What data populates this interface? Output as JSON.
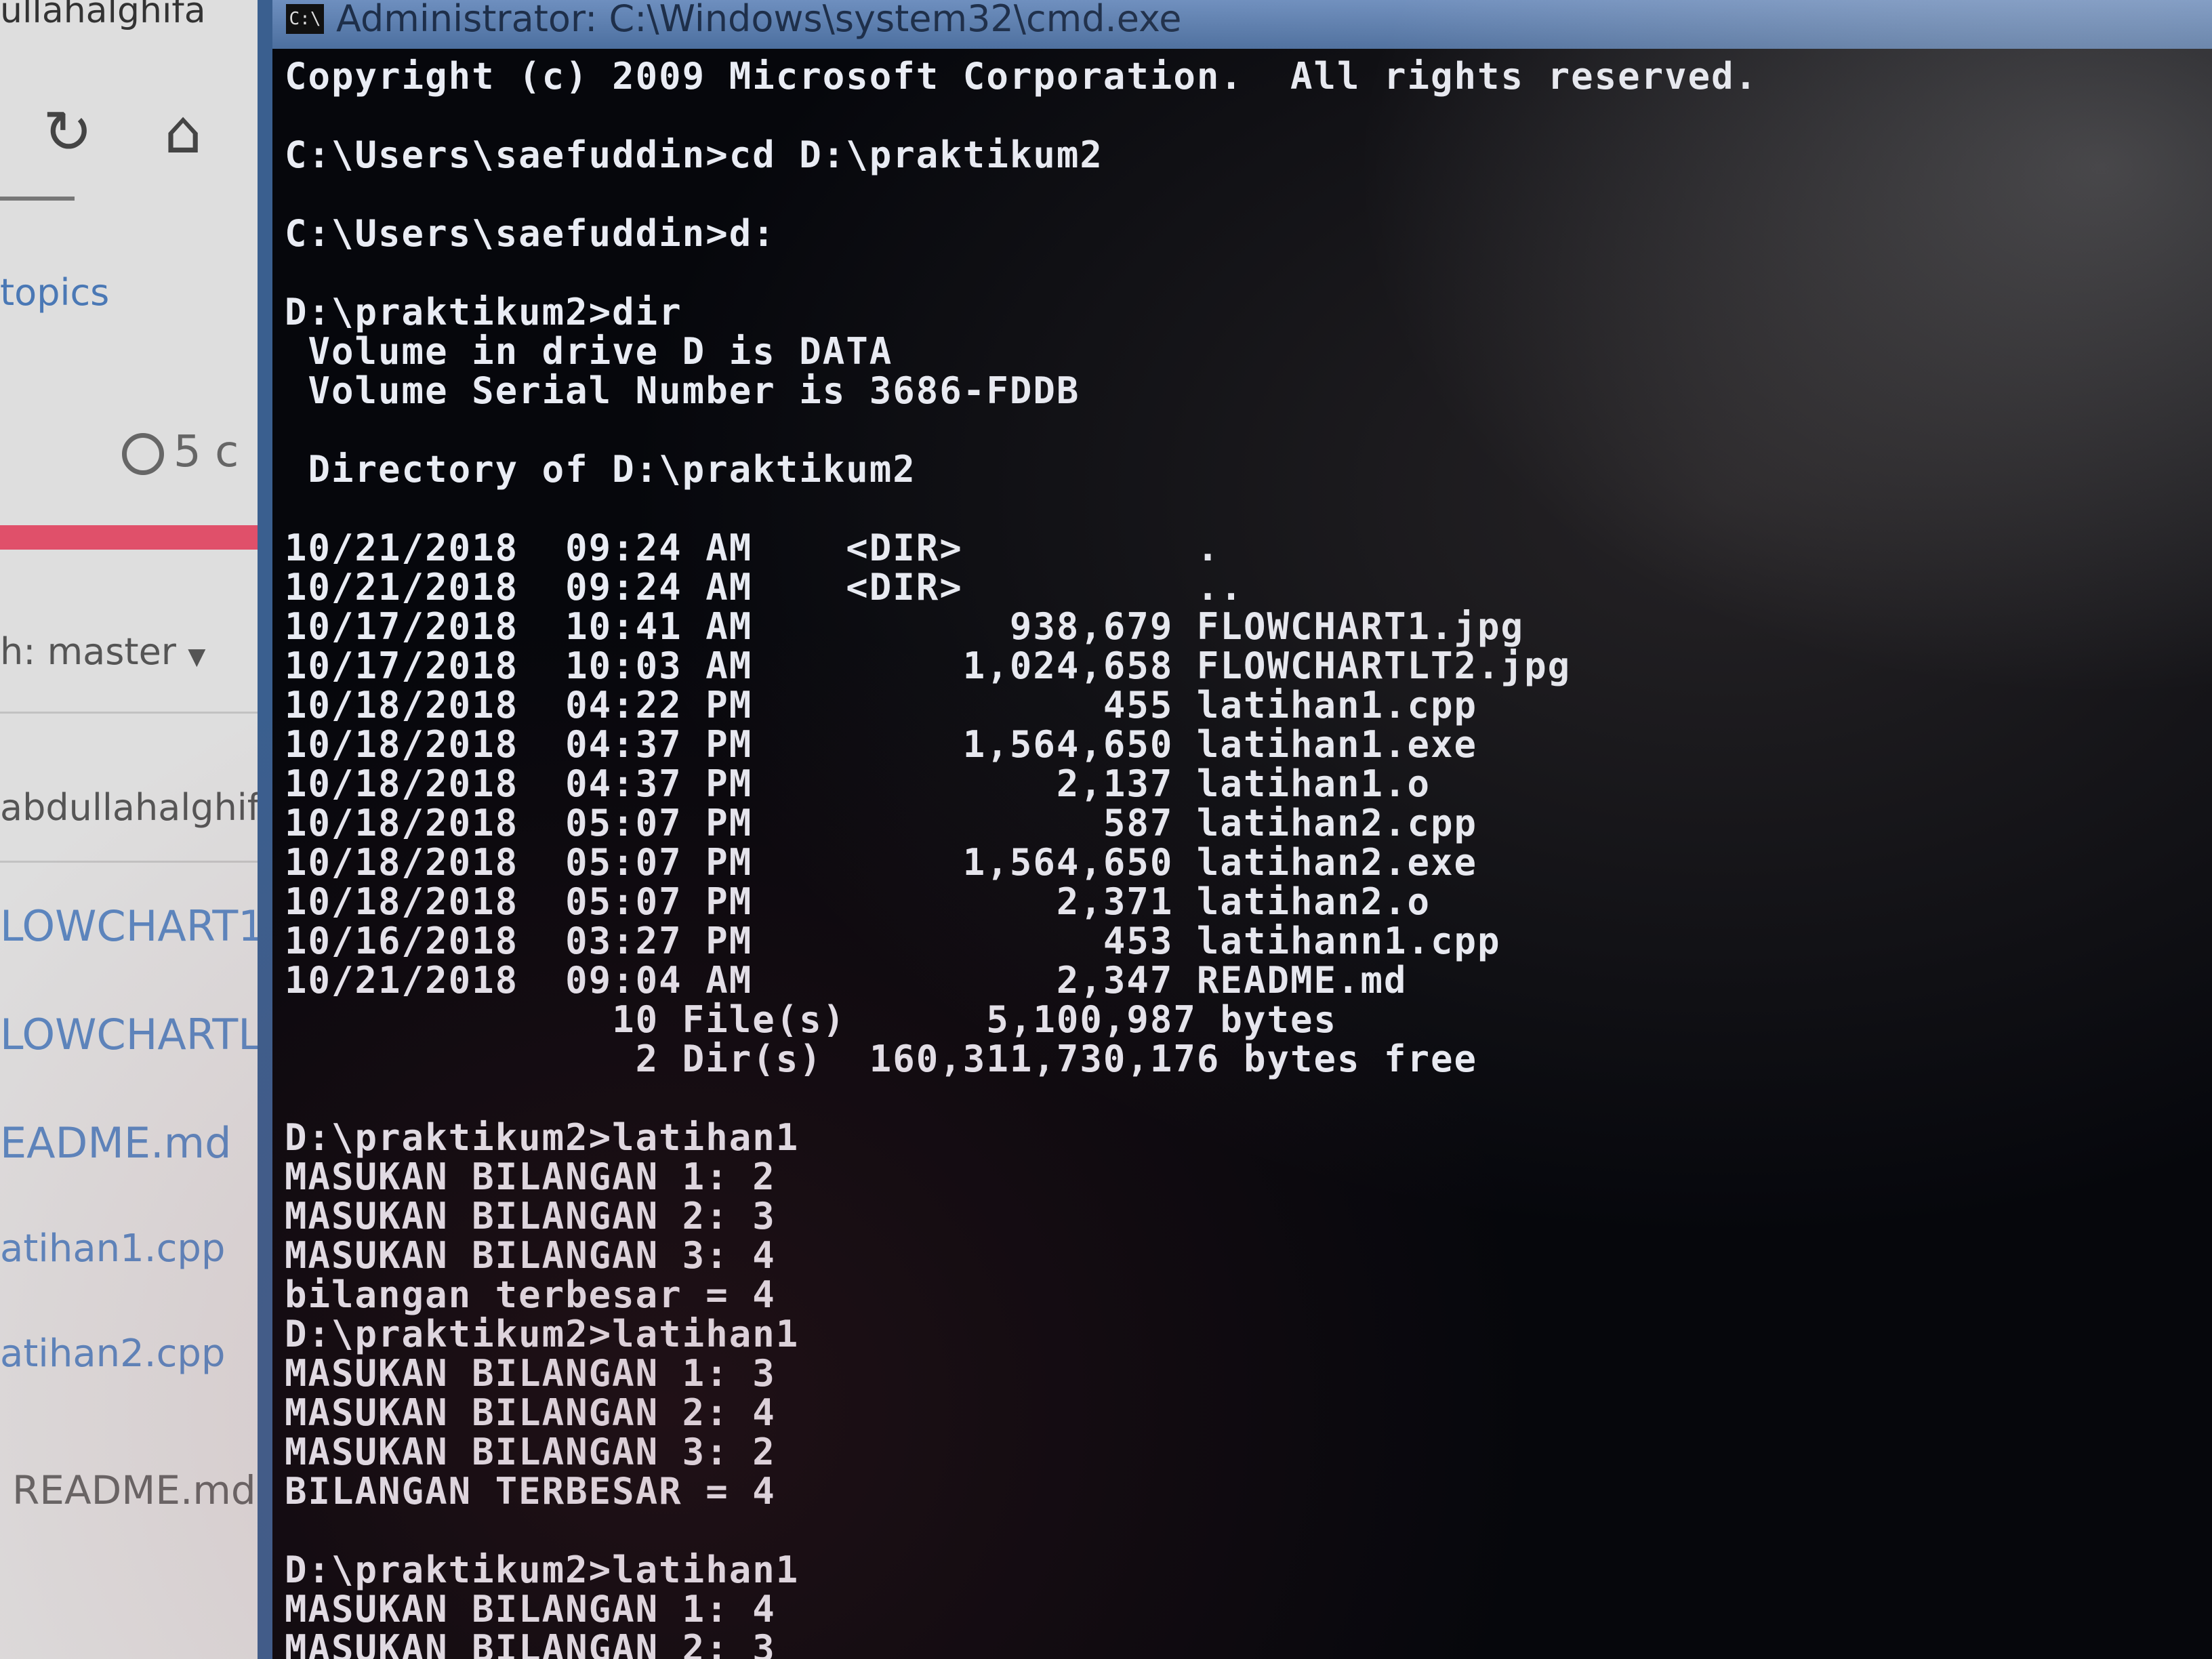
{
  "browser": {
    "url_fragment": "ullahalghifa",
    "reload_icon": "reload-icon",
    "home_icon": "home-icon",
    "topics_link": "topics",
    "history_count": "5 c",
    "branch_label": "h: master",
    "commit_author": "abdullahalghif",
    "files": [
      "LOWCHART1",
      "LOWCHARTL",
      "EADME.md",
      "atihan1.cpp",
      "atihan2.cpp",
      "README.md"
    ]
  },
  "console": {
    "title": "Administrator: C:\\Windows\\system32\\cmd.exe",
    "lines": [
      "Copyright (c) 2009 Microsoft Corporation.  All rights reserved.",
      "",
      "C:\\Users\\saefuddin>cd D:\\praktikum2",
      "",
      "C:\\Users\\saefuddin>d:",
      "",
      "D:\\praktikum2>dir",
      " Volume in drive D is DATA",
      " Volume Serial Number is 3686-FDDB",
      "",
      " Directory of D:\\praktikum2",
      "",
      "10/21/2018  09:24 AM    <DIR>          .",
      "10/21/2018  09:24 AM    <DIR>          ..",
      "10/17/2018  10:41 AM           938,679 FLOWCHART1.jpg",
      "10/17/2018  10:03 AM         1,024,658 FLOWCHARTLT2.jpg",
      "10/18/2018  04:22 PM               455 latihan1.cpp",
      "10/18/2018  04:37 PM         1,564,650 latihan1.exe",
      "10/18/2018  04:37 PM             2,137 latihan1.o",
      "10/18/2018  05:07 PM               587 latihan2.cpp",
      "10/18/2018  05:07 PM         1,564,650 latihan2.exe",
      "10/18/2018  05:07 PM             2,371 latihan2.o",
      "10/16/2018  03:27 PM               453 latihann1.cpp",
      "10/21/2018  09:04 AM             2,347 README.md",
      "              10 File(s)      5,100,987 bytes",
      "               2 Dir(s)  160,311,730,176 bytes free",
      "",
      "D:\\praktikum2>latihan1",
      "MASUKAN BILANGAN 1: 2",
      "MASUKAN BILANGAN 2: 3",
      "MASUKAN BILANGAN 3: 4",
      "bilangan terbesar = 4",
      "D:\\praktikum2>latihan1",
      "MASUKAN BILANGAN 1: 3",
      "MASUKAN BILANGAN 2: 4",
      "MASUKAN BILANGAN 3: 2",
      "BILANGAN TERBESAR = 4",
      "",
      "D:\\praktikum2>latihan1",
      "MASUKAN BILANGAN 1: 4",
      "MASUKAN BILANGAN 2: 3"
    ]
  }
}
